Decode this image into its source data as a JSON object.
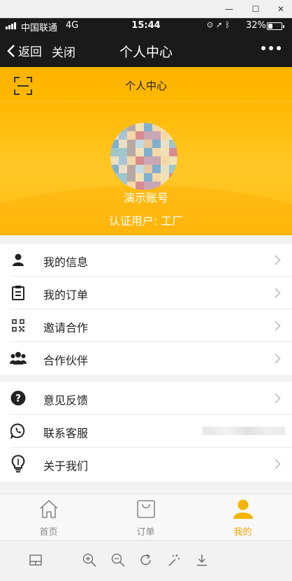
{
  "window": {
    "minimize": "—",
    "maximize": "☐",
    "close": "✕"
  },
  "status_bar": {
    "carrier": "中国联通",
    "network": "4G",
    "time": "15:44",
    "battery": "32%",
    "battery_level": 0.32
  },
  "nav": {
    "back_label": "返回",
    "close_label": "关闭",
    "title": "个人中心"
  },
  "header": {
    "title": "个人中心",
    "account_name": "演示账号",
    "certification": "认证用户: 工厂"
  },
  "menu": {
    "group1": [
      {
        "label": "我的信息",
        "icon": "person-icon"
      },
      {
        "label": "我的订单",
        "icon": "clipboard-icon"
      },
      {
        "label": "邀请合作",
        "icon": "qrcode-icon"
      },
      {
        "label": "合作伙伴",
        "icon": "group-icon"
      }
    ],
    "group2": [
      {
        "label": "意见反馈",
        "icon": "question-icon"
      },
      {
        "label": "联系客服",
        "icon": "phone-chat-icon"
      },
      {
        "label": "关于我们",
        "icon": "lightbulb-icon"
      }
    ]
  },
  "tabs": [
    {
      "label": "首页",
      "icon": "home-icon",
      "active": false
    },
    {
      "label": "订单",
      "icon": "bag-icon",
      "active": false
    },
    {
      "label": "我的",
      "icon": "user-icon",
      "active": true
    }
  ],
  "toolbar_icons": [
    "layout-icon",
    "zoom-in-icon",
    "zoom-out-icon",
    "rotate-icon",
    "magic-wand-icon",
    "download-icon"
  ],
  "colors": {
    "accent": "#ffb300",
    "active_tab": "#f5a300",
    "nav_bg": "#1a1a1a"
  }
}
